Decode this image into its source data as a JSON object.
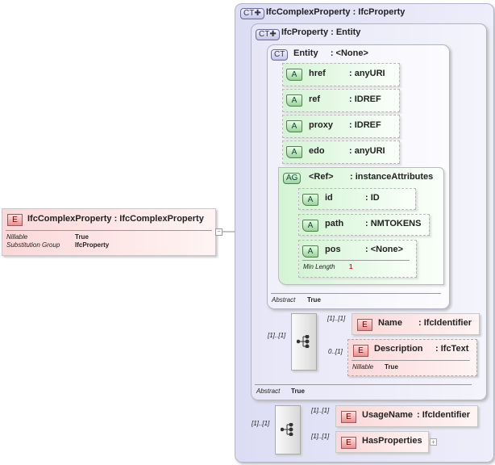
{
  "root": {
    "badge": "E",
    "title": "IfcComplexProperty : IfcComplexProperty",
    "props": [
      {
        "key": "Nillable",
        "value": "True"
      },
      {
        "key": "Substitution Group",
        "value": "IfcProperty"
      }
    ]
  },
  "ct_outer": {
    "badge": "CT",
    "title": "IfcComplexProperty : IfcProperty"
  },
  "ct_mid": {
    "badge": "CT",
    "title": "IfcProperty : Entity",
    "abstract_key": "Abstract",
    "abstract_value": "True"
  },
  "ct_entity": {
    "badge": "CT",
    "title": "Entity     : <None>",
    "abstract_key": "Abstract",
    "abstract_value": "True"
  },
  "attributes": [
    {
      "badge": "A",
      "name": "href",
      "type": ": anyURI"
    },
    {
      "badge": "A",
      "name": "ref",
      "type": ": IDREF"
    },
    {
      "badge": "A",
      "name": "proxy",
      "type": ": IDREF"
    },
    {
      "badge": "A",
      "name": "edo",
      "type": ": anyURI"
    }
  ],
  "attr_group": {
    "badge": "AG",
    "name": "<Ref>",
    "type": ": instanceAttributes",
    "attributes": [
      {
        "badge": "A",
        "name": "id",
        "type": ": ID"
      },
      {
        "badge": "A",
        "name": "path",
        "type": ": NMTOKENS"
      },
      {
        "badge": "A",
        "name": "pos",
        "type": ": <None>",
        "prop_key": "Min Length",
        "prop_value": "1"
      }
    ]
  },
  "seq1": {
    "card": "[1]..[1]",
    "elements": [
      {
        "badge": "E",
        "name": "Name",
        "type": ": IfcIdentifier",
        "card": "[1]..[1]"
      },
      {
        "badge": "E",
        "name": "Description",
        "type": ": IfcText",
        "card": "0..[1]",
        "prop_key": "Nillable",
        "prop_value": "True"
      }
    ]
  },
  "seq2": {
    "card": "[1]..[1]",
    "elements": [
      {
        "badge": "E",
        "name": "UsageName",
        "type": ": IfcIdentifier",
        "card": "[1]..[1]"
      },
      {
        "badge": "E",
        "name": "HasProperties",
        "type": "",
        "card": "[1]..[1]"
      }
    ]
  }
}
